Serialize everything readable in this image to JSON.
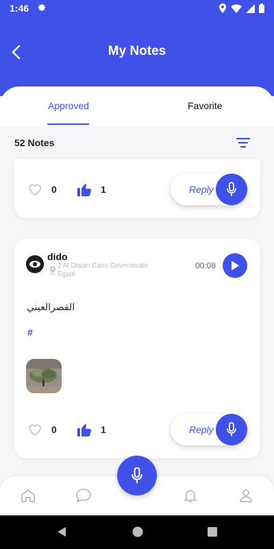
{
  "status_bar": {
    "time": "1:46"
  },
  "header": {
    "title": "My Notes"
  },
  "tabs": [
    {
      "label": "Approved",
      "active": true
    },
    {
      "label": "Favorite",
      "active": false
    }
  ],
  "notes": {
    "count_label": "52 Notes"
  },
  "cards": [
    {
      "likes": "0",
      "thumbs_up": "1",
      "reply_label": "Reply"
    },
    {
      "user": "dido",
      "location": "2 Al Diwan Cairo Governorate Egypt",
      "duration": "00:08",
      "text": "القصرالعيني",
      "hashtag": "#",
      "likes": "0",
      "thumbs_up": "1",
      "reply_label": "Reply"
    }
  ],
  "bottom_nav": {
    "items": [
      "home-icon",
      "chat-icon",
      "bell-icon",
      "profile-icon"
    ]
  },
  "colors": {
    "accent": "#3f51e8",
    "background": "#f5f5f7"
  }
}
